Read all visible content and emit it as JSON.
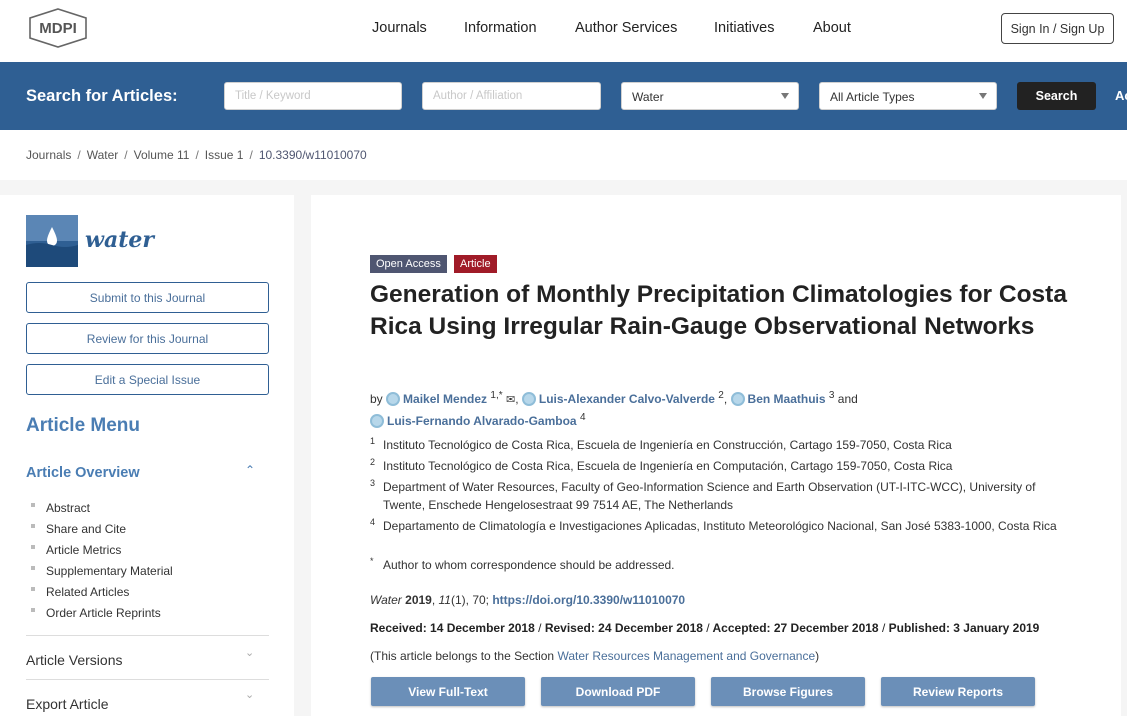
{
  "brand": {
    "logo_text": "MDPI"
  },
  "topnav": {
    "items": [
      "Journals",
      "Information",
      "Author Services",
      "Initiatives",
      "About"
    ],
    "signin": "Sign In / Sign Up"
  },
  "search": {
    "label": "Search for Articles:",
    "title_placeholder": "Title / Keyword",
    "author_placeholder": "Author / Affiliation",
    "journal_value": "Water",
    "type_value": "All Article Types",
    "button": "Search",
    "advanced_partial": "Ac"
  },
  "breadcrumb": {
    "items": [
      "Journals",
      "Water",
      "Volume 11",
      "Issue 1",
      "10.3390/w11010070"
    ],
    "sep": "/"
  },
  "sidebar": {
    "journal_name": "water",
    "buttons": [
      "Submit to this Journal",
      "Review for this Journal",
      "Edit a Special Issue"
    ],
    "menu_title": "Article Menu",
    "overview_title": "Article Overview",
    "overview_items": [
      "Abstract",
      "Share and Cite",
      "Article Metrics",
      "Supplementary Material",
      "Related Articles",
      "Order Article Reprints"
    ],
    "sections": [
      "Article Versions",
      "Export Article"
    ]
  },
  "article": {
    "badge_open": "Open Access",
    "badge_type": "Article",
    "title": "Generation of Monthly Precipitation Climatologies for Costa Rica Using Irregular Rain-Gauge Observational Networks",
    "by": "by",
    "and": "and",
    "authors": [
      {
        "name": "Maikel Mendez",
        "sup": "1,*"
      },
      {
        "name": "Luis-Alexander Calvo-Valverde",
        "sup": "2"
      },
      {
        "name": "Ben Maathuis",
        "sup": "3"
      },
      {
        "name": "Luis-Fernando Alvarado-Gamboa",
        "sup": "4"
      }
    ],
    "affiliations": [
      {
        "sup": "1",
        "text": "Instituto Tecnológico de Costa Rica, Escuela de Ingeniería en Construcción, Cartago 159-7050, Costa Rica"
      },
      {
        "sup": "2",
        "text": "Instituto Tecnológico de Costa Rica, Escuela de Ingeniería en Computación, Cartago 159-7050, Costa Rica"
      },
      {
        "sup": "3",
        "text": "Department of Water Resources, Faculty of Geo-Information Science and Earth Observation (UT-I-ITC-WCC), University of Twente, Enschede Hengelosestraat 99 7514 AE, The Netherlands"
      },
      {
        "sup": "4",
        "text": "Departamento de Climatología e Investigaciones Aplicadas, Instituto Meteorológico Nacional, San José 5383-1000, Costa Rica"
      },
      {
        "sup": "*",
        "text": "Author to whom correspondence should be addressed."
      }
    ],
    "citation": {
      "journal": "Water",
      "year": "2019",
      "volume": "11",
      "issue_pages": "(1), 70;",
      "doi": "https://doi.org/10.3390/w11010070"
    },
    "dates": {
      "received": "Received: 14 December 2018",
      "revised": "Revised: 24 December 2018",
      "accepted": "Accepted: 27 December 2018",
      "published": "Published: 3 January 2019",
      "sep": "/"
    },
    "section_prefix": "(This article belongs to the Section",
    "section_name": "Water Resources Management and Governance",
    "section_suffix": ")",
    "actions": [
      "View Full-Text",
      "Download PDF",
      "Browse Figures",
      "Review Reports"
    ]
  },
  "colors": {
    "header_blue": "#2f5f93",
    "link": "#4a6f9a",
    "article_badge": "#a01b28",
    "open_badge": "#4f5671",
    "action_btn": "#6b8fb8"
  }
}
